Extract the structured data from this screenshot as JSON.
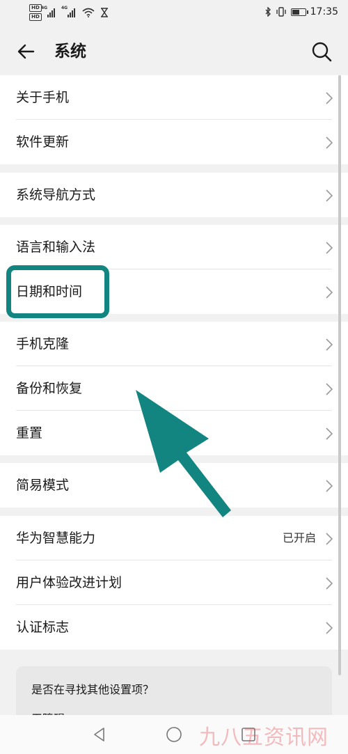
{
  "status_bar": {
    "hd1": "HD",
    "hd2": "HD",
    "sig1_tag": "4G",
    "sig2_tag": "4G",
    "time": "17:35",
    "battery_level": 0.6
  },
  "header": {
    "title": "系统"
  },
  "groups": [
    {
      "items": [
        {
          "label": "关于手机"
        },
        {
          "label": "软件更新"
        }
      ]
    },
    {
      "items": [
        {
          "label": "系统导航方式"
        }
      ]
    },
    {
      "items": [
        {
          "label": "语言和输入法"
        },
        {
          "label": "日期和时间"
        }
      ]
    },
    {
      "items": [
        {
          "label": "手机克隆"
        },
        {
          "label": "备份和恢复"
        },
        {
          "label": "重置"
        }
      ]
    },
    {
      "items": [
        {
          "label": "简易模式"
        }
      ]
    },
    {
      "items": [
        {
          "label": "华为智慧能力",
          "value": "已开启"
        },
        {
          "label": "用户体验改进计划"
        },
        {
          "label": "认证标志"
        }
      ]
    }
  ],
  "suggestion_card": {
    "question": "是否在寻找其他设置项？",
    "link": "无障碍"
  },
  "watermark": "九八五资讯网",
  "colors": {
    "highlight": "#138581",
    "arrow": "#138581",
    "watermark": "#e8454f"
  }
}
